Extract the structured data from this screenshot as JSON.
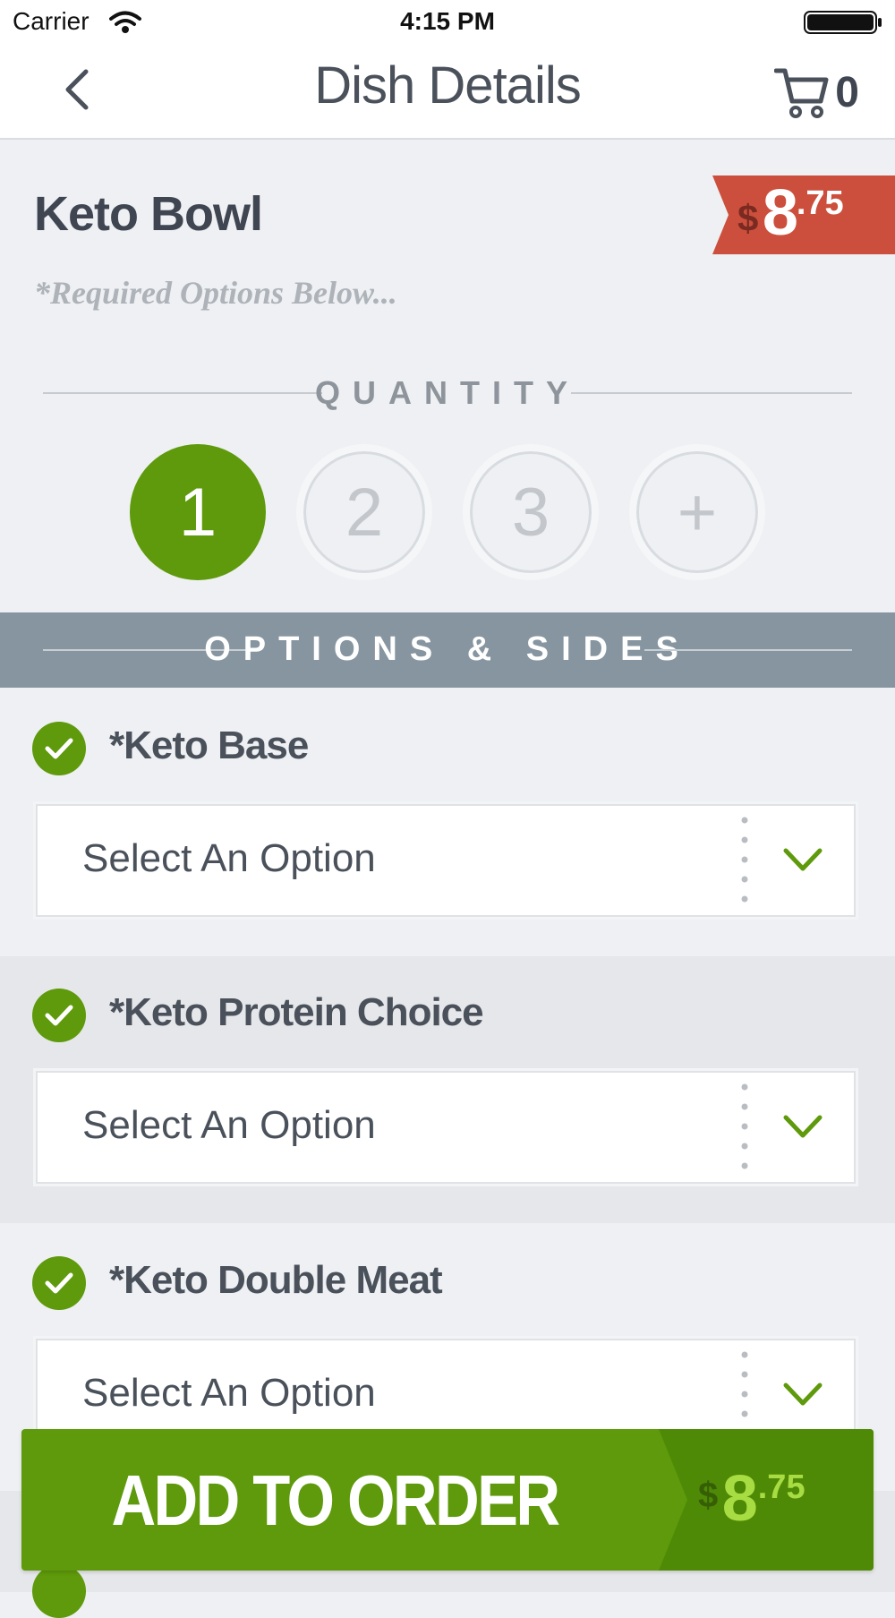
{
  "status_bar": {
    "carrier": "Carrier",
    "time": "4:15 PM"
  },
  "nav": {
    "title": "Dish Details",
    "cart_count": "0"
  },
  "dish": {
    "name": "Keto Bowl",
    "required_note": "*Required Options Below...",
    "price": {
      "currency": "$",
      "whole": "8",
      "fraction": ".75"
    }
  },
  "quantity": {
    "label": "QUANTITY",
    "options": [
      "1",
      "2",
      "3",
      "+"
    ],
    "selected": "1"
  },
  "options_header": "OPTIONS & SIDES",
  "option_groups": [
    {
      "label": "*Keto Base",
      "select_value": "Select An Option"
    },
    {
      "label": "*Keto Protein Choice",
      "select_value": "Select An Option"
    },
    {
      "label": "*Keto Double Meat",
      "select_value": "Select An Option"
    }
  ],
  "add_button": {
    "label": "ADD TO ORDER",
    "currency": "$",
    "whole": "8",
    "fraction": ".75"
  },
  "colors": {
    "accent_green": "#5e9a0b",
    "price_red": "#cc4f3d",
    "options_header_bg": "#8695a0"
  }
}
